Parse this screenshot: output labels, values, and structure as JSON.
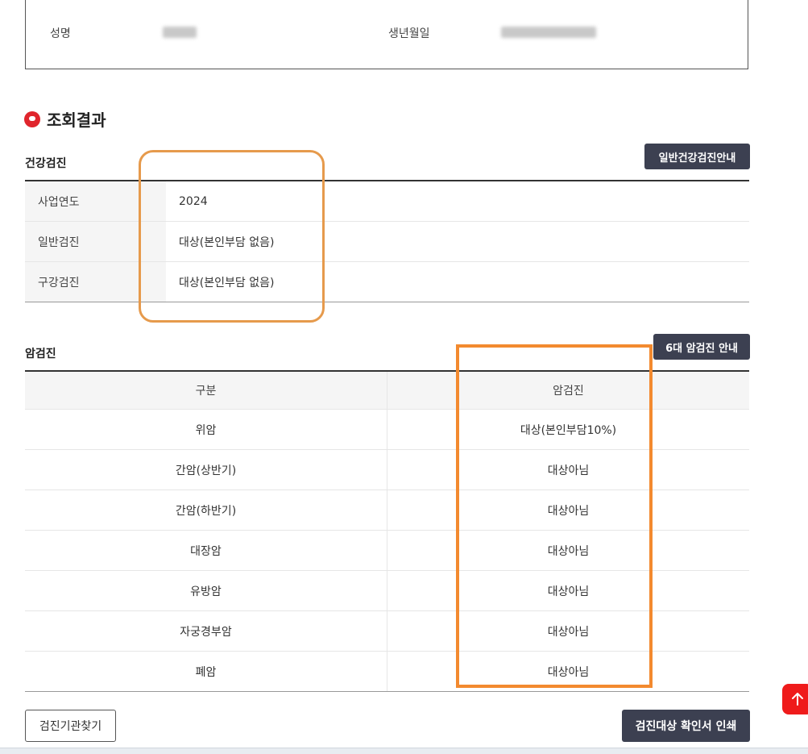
{
  "personal_info": {
    "name_label": "성명",
    "birth_label": "생년월일"
  },
  "result": {
    "title": "조회결과",
    "icon": "speech-pin-icon"
  },
  "health_checkup": {
    "section_label": "건강검진",
    "guide_button": "일반건강검진안내",
    "rows": [
      {
        "label": "사업연도",
        "value": "2024"
      },
      {
        "label": "일반검진",
        "value": "대상(본인부담 없음)"
      },
      {
        "label": "구강검진",
        "value": "대상(본인부담 없음)"
      }
    ]
  },
  "cancer_checkup": {
    "section_label": "암검진",
    "guide_button": "6대 암검진 안내",
    "columns": [
      "구분",
      "암검진"
    ],
    "rows": [
      {
        "type": "위암",
        "status": "대상(본인부담10%)"
      },
      {
        "type": "간암(상반기)",
        "status": "대상아님"
      },
      {
        "type": "간암(하반기)",
        "status": "대상아님"
      },
      {
        "type": "대장암",
        "status": "대상아님"
      },
      {
        "type": "유방암",
        "status": "대상아님"
      },
      {
        "type": "자궁경부암",
        "status": "대상아님"
      },
      {
        "type": "폐암",
        "status": "대상아님"
      }
    ]
  },
  "actions": {
    "find_institution": "검진기관찾기",
    "print_certificate": "검진대상 확인서 인쇄",
    "scroll_top_icon": "arrow-up-icon"
  },
  "colors": {
    "accent_red": "#e0252c",
    "dark_button": "#3c4051",
    "highlight_orange": "#f38a2f"
  }
}
